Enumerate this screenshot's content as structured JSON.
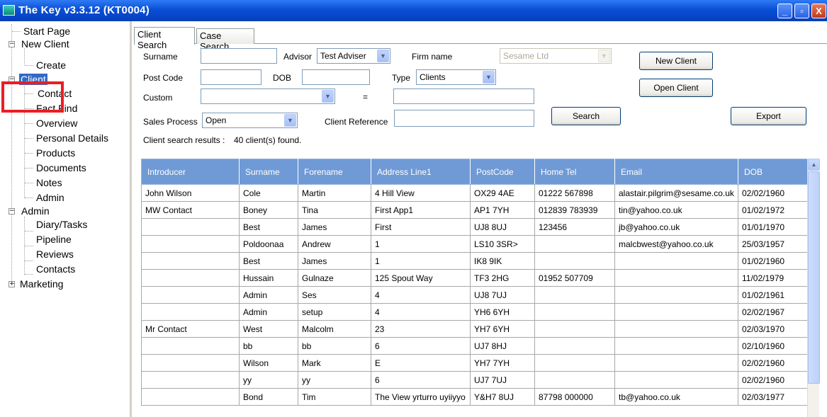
{
  "window": {
    "title": "The Key v3.3.12 (KT0004)",
    "min": "_",
    "max": "▫",
    "close": "X"
  },
  "tree": {
    "start_page": "Start Page",
    "new_client": "New Client",
    "create": "Create",
    "client": "Client",
    "contact": "Contact",
    "fact_find": "Fact Find",
    "overview": "Overview",
    "personal_details": "Personal Details",
    "products": "Products",
    "documents": "Documents",
    "notes": "Notes",
    "admin_child": "Admin",
    "admin": "Admin",
    "diary": "Diary/Tasks",
    "pipeline": "Pipeline",
    "reviews": "Reviews",
    "contacts": "Contacts",
    "marketing": "Marketing",
    "collapse_sign": "−",
    "expand_sign": "+"
  },
  "tabs": {
    "client_search": "Client Search",
    "case_search": "Case Search"
  },
  "form": {
    "surname_label": "Surname",
    "surname_value": "",
    "advisor_label": "Advisor",
    "advisor_value": "Test Adviser",
    "firm_label": "Firm name",
    "firm_value": "Sesame Ltd",
    "postcode_label": "Post Code",
    "postcode_value": "",
    "dob_label": "DOB",
    "dob_value": "",
    "type_label": "Type",
    "type_value": "Clients",
    "custom_label": "Custom",
    "custom_value": "",
    "equals": "=",
    "custom_text": "",
    "sales_label": "Sales Process",
    "sales_value": "Open",
    "client_ref_label": "Client Reference",
    "client_ref_value": "",
    "results_label": "Client search results :",
    "results_count": "40 client(s) found.",
    "dropdown_arrow": "▼"
  },
  "buttons": {
    "new_client": "New Client",
    "open_client": "Open Client",
    "search": "Search",
    "export": "Export"
  },
  "grid": {
    "columns": [
      "Introducer",
      "Surname",
      "Forename",
      "Address Line1",
      "PostCode",
      "Home Tel",
      "Email",
      "DOB"
    ],
    "rows": [
      [
        "John Wilson",
        "Cole",
        "Martin",
        "4 Hill View",
        "OX29 4AE",
        "01222 567898",
        "alastair.pilgrim@sesame.co.uk",
        "02/02/1960"
      ],
      [
        "MW Contact",
        "Boney",
        "Tina",
        "First App1",
        "AP1 7YH",
        "012839 783939",
        "tin@yahoo.co.uk",
        "01/02/1972"
      ],
      [
        "",
        "Best",
        "James",
        "First",
        "UJ8 8UJ",
        "123456",
        "jb@yahoo.co.uk",
        "01/01/1970"
      ],
      [
        "",
        "Poldoonaa",
        "Andrew",
        "1",
        "LS10 3SR>",
        "",
        "malcbwest@yahoo.co.uk",
        "25/03/1957"
      ],
      [
        "",
        "Best",
        "James",
        "1",
        "IK8 9IK",
        "",
        "",
        "01/02/1960"
      ],
      [
        "",
        "Hussain",
        "Gulnaze",
        "125 Spout Way",
        "TF3 2HG",
        "01952 507709",
        "",
        "11/02/1979"
      ],
      [
        "",
        "Admin",
        "Ses",
        "4",
        "UJ8 7UJ",
        "",
        "",
        "01/02/1961"
      ],
      [
        "",
        "Admin",
        "setup",
        "4",
        "YH6 6YH",
        "",
        "",
        "02/02/1967"
      ],
      [
        "Mr Contact",
        "West",
        "Malcolm",
        "23",
        "YH7 6YH",
        "",
        "",
        "02/03/1970"
      ],
      [
        "",
        "bb",
        "bb",
        "6",
        "UJ7 8HJ",
        "",
        "",
        "02/10/1960"
      ],
      [
        "",
        "Wilson",
        "Mark",
        "E",
        "YH7 7YH",
        "",
        "",
        "02/02/1960"
      ],
      [
        "",
        "yy",
        "yy",
        "6",
        "UJ7 7UJ",
        "",
        "",
        "02/02/1960"
      ],
      [
        "",
        "Bond",
        "Tim",
        "The View yrturro uyiiyyo",
        "Y&H7 8UJ",
        "87798 000000",
        "tb@yahoo.co.uk",
        "02/03/1977"
      ]
    ],
    "scroll_up": "▲"
  }
}
